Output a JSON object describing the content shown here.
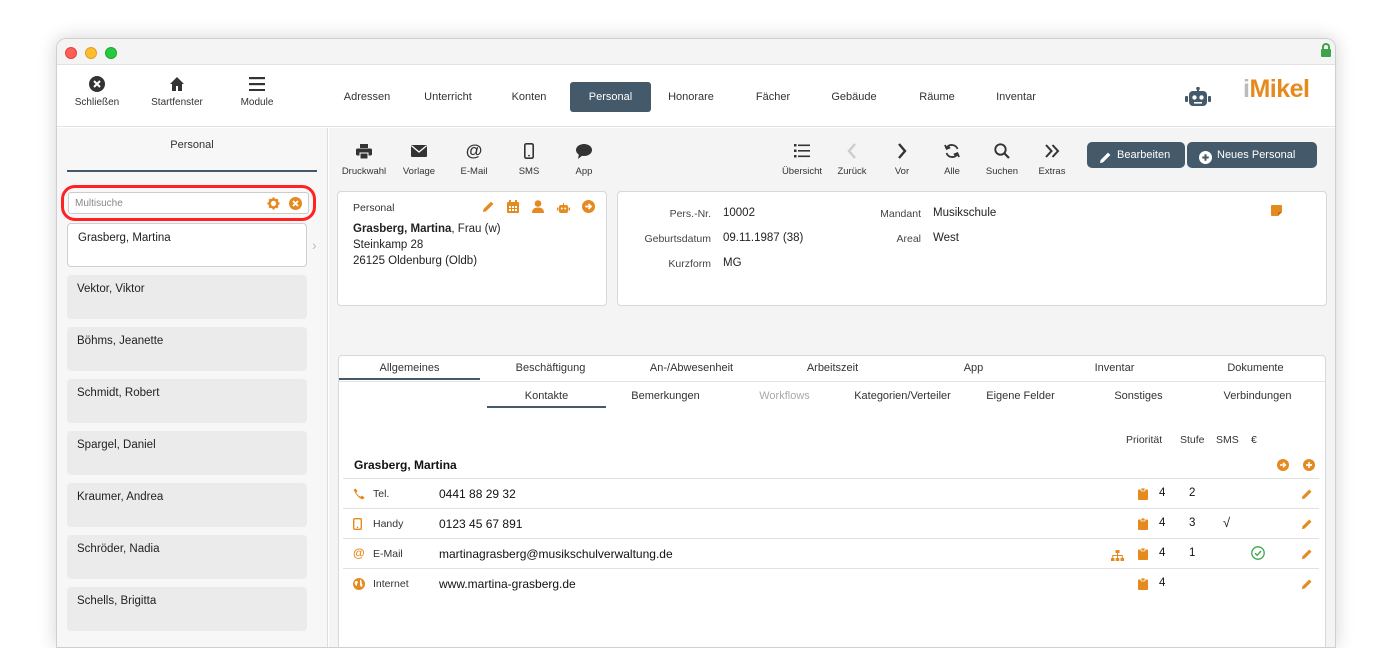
{
  "toolbar": {
    "close": "Schließen",
    "home": "Startfenster",
    "modules": "Module"
  },
  "nav": {
    "tabs": [
      "Adressen",
      "Unterricht",
      "Konten",
      "Personal",
      "Honorare",
      "Fächer",
      "Gebäude",
      "Räume",
      "Inventar"
    ],
    "active": "Personal"
  },
  "logo": {
    "prefix": "i",
    "name": "Mikel"
  },
  "sidebar": {
    "title": "Personal",
    "search_placeholder": "Multisuche",
    "items": [
      "Grasberg, Martina",
      "Vektor, Viktor",
      "Böhms, Jeanette",
      "Schmidt, Robert",
      "Spargel, Daniel",
      "Kraumer, Andrea",
      "Schröder, Nadia",
      "Schells, Brigitta"
    ]
  },
  "actions": {
    "druckwahl": "Druckwahl",
    "vorlage": "Vorlage",
    "email": "E-Mail",
    "sms": "SMS",
    "app": "App",
    "uebersicht": "Übersicht",
    "zurueck": "Zurück",
    "vor": "Vor",
    "alle": "Alle",
    "suchen": "Suchen",
    "extras": "Extras",
    "bearbeiten": "Bearbeiten",
    "neues_personal": "Neues Personal"
  },
  "person": {
    "card_label": "Personal",
    "name": "Grasberg, Martina",
    "salutation": ", Frau (w)",
    "street": "Steinkamp 28",
    "city": "26125 Oldenburg (Oldb)"
  },
  "details": {
    "pers_nr_label": "Pers.-Nr.",
    "pers_nr": "10002",
    "geburtsdatum_label": "Geburtsdatum",
    "geburtsdatum": "09.11.1987 (38)",
    "kurzform_label": "Kurzform",
    "kurzform": "MG",
    "mandant_label": "Mandant",
    "mandant": "Musikschule",
    "areal_label": "Areal",
    "areal": "West"
  },
  "tabs_primary": [
    "Allgemeines",
    "Beschäftigung",
    "An-/Abwesenheit",
    "Arbeitszeit",
    "App",
    "Inventar",
    "Dokumente"
  ],
  "tabs_secondary": [
    "Kontakte",
    "Bemerkungen",
    "Workflows",
    "Kategorien/Verteiler",
    "Eigene Felder",
    "Sonstiges",
    "Verbindungen"
  ],
  "contacts": {
    "headers": {
      "prioritaet": "Priorität",
      "stufe": "Stufe",
      "sms": "SMS",
      "euro": "€"
    },
    "owner": "Grasberg, Martina",
    "rows": [
      {
        "type": "Tel.",
        "value": "0441 88 29 32",
        "prio": "4",
        "stufe": "2",
        "sms": "",
        "icon": "phone-icon"
      },
      {
        "type": "Handy",
        "value": "0123 45 67 891",
        "prio": "4",
        "stufe": "3",
        "sms": "√",
        "icon": "mobile-icon"
      },
      {
        "type": "E-Mail",
        "value": "martinagrasberg@musikschulverwaltung.de",
        "prio": "4",
        "stufe": "1",
        "sms": "",
        "icon": "at-icon"
      },
      {
        "type": "Internet",
        "value": "www.martina-grasberg.de",
        "prio": "4",
        "stufe": "",
        "sms": "",
        "icon": "globe-icon"
      }
    ]
  },
  "colors": {
    "accent": "#e58a1f",
    "dark": "#44596a"
  }
}
